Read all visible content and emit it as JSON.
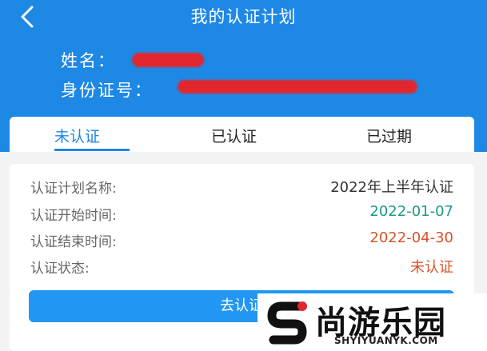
{
  "header": {
    "title": "我的认证计划",
    "back_icon": "chevron-left-icon",
    "name_label": "姓名：",
    "id_label": "身份证号："
  },
  "tabs": [
    {
      "label": "未认证",
      "active": true
    },
    {
      "label": "已认证",
      "active": false
    },
    {
      "label": "已过期",
      "active": false
    }
  ],
  "plan": {
    "rows": [
      {
        "label": "认证计划名称:",
        "value": "2022年上半年认证",
        "color": "#333333"
      },
      {
        "label": "认证开始时间:",
        "value": "2022-01-07",
        "color": "#1a9a8a"
      },
      {
        "label": "认证结束时间:",
        "value": "2022-04-30",
        "color": "#d9532b"
      },
      {
        "label": "认证状态:",
        "value": "未认证",
        "color": "#d9532b"
      }
    ],
    "button_label": "去认证"
  },
  "watermark": {
    "text": "尚游乐园",
    "url": "SHYIYUANYK.COM"
  },
  "colors": {
    "brand_blue": "#1e88e5",
    "button_blue": "#2196f3",
    "redaction_red": "#e1272d"
  }
}
